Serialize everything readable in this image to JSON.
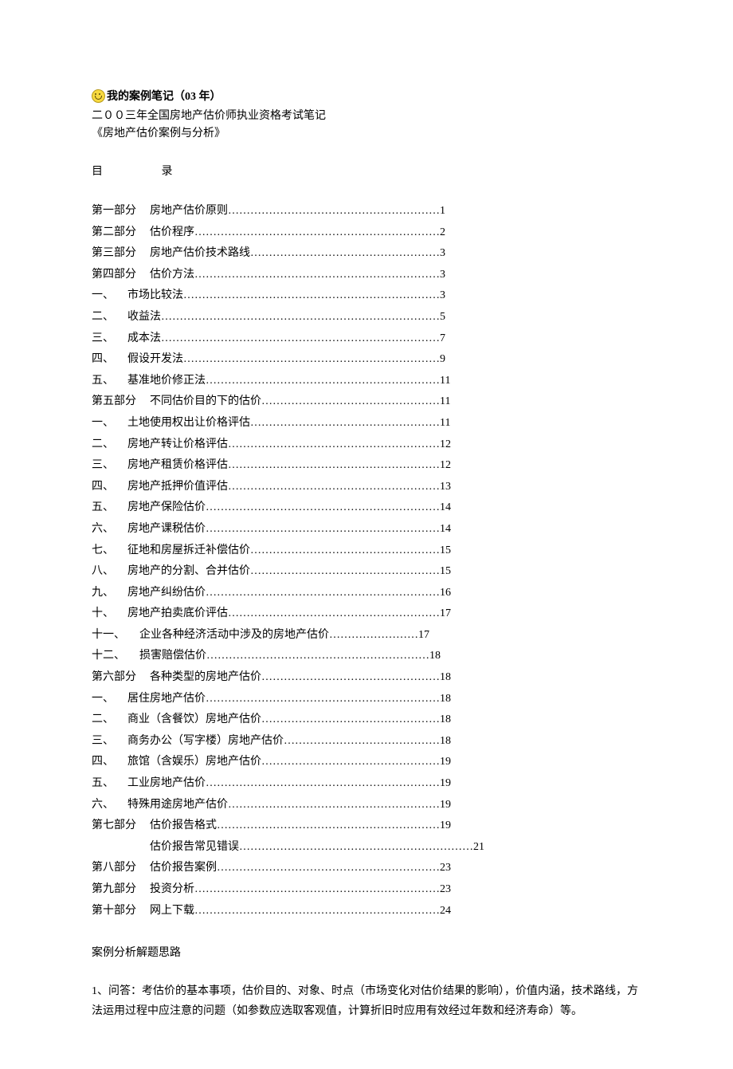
{
  "title": "我的案例笔记（03 年）",
  "subtitle1": "二００三年全国房地产估价师执业资格考试笔记",
  "subtitle2": "《房地产估价案例与分析》",
  "mu": "目",
  "lu": "录",
  "toc": [
    {
      "label": "第一部分",
      "cls": "toc-label1",
      "text": "房地产估价原则",
      "dots": "…………………………………………………",
      "page": "1"
    },
    {
      "label": "第二部分",
      "cls": "toc-label1",
      "text": "估价程序",
      "dots": "…………………………………………………………",
      "page": "2"
    },
    {
      "label": "第三部分",
      "cls": "toc-label1",
      "text": "房地产估价技术路线",
      "dots": "……………………………………………",
      "page": "3"
    },
    {
      "label": "第四部分",
      "cls": "toc-label1",
      "text": "估价方法",
      "dots": "…………………………………………………………",
      "page": "3"
    },
    {
      "label": "一、",
      "cls": "toc-label2",
      "text": "市场比较法",
      "dots": "……………………………………………………………",
      "page": "3"
    },
    {
      "label": "二、",
      "cls": "toc-label2",
      "text": "收益法",
      "dots": "…………………………………………………………………",
      "page": "5"
    },
    {
      "label": "三、",
      "cls": "toc-label2",
      "text": "成本法",
      "dots": "…………………………………………………………………",
      "page": "7"
    },
    {
      "label": "四、",
      "cls": "toc-label2",
      "text": "假设开发法",
      "dots": "……………………………………………………………",
      "page": "9"
    },
    {
      "label": "五、",
      "cls": "toc-label2",
      "text": "基准地价修正法",
      "dots": "………………………………………………………",
      "page": "11"
    },
    {
      "label": "第五部分",
      "cls": "toc-label1",
      "text": "不同估价目的下的估价",
      "dots": "…………………………………………",
      "page": "11"
    },
    {
      "label": "一、",
      "cls": "toc-label2",
      "text": "土地使用权出让价格评估",
      "dots": "……………………………………………",
      "page": "11"
    },
    {
      "label": "二、",
      "cls": "toc-label2",
      "text": "房地产转让价格评估",
      "dots": "…………………………………………………",
      "page": "12"
    },
    {
      "label": "三、",
      "cls": "toc-label2",
      "text": "房地产租赁价格评估",
      "dots": "…………………………………………………",
      "page": "12"
    },
    {
      "label": "四、",
      "cls": "toc-label2",
      "text": "房地产抵押价值评估",
      "dots": "…………………………………………………",
      "page": "13"
    },
    {
      "label": "五、",
      "cls": "toc-label2",
      "text": "房地产保险估价",
      "dots": "………………………………………………………",
      "page": "14"
    },
    {
      "label": "六、",
      "cls": "toc-label2",
      "text": "房地产课税估价",
      "dots": "………………………………………………………",
      "page": "14"
    },
    {
      "label": "七、",
      "cls": "toc-label2",
      "text": "征地和房屋拆迁补偿估价",
      "dots": "……………………………………………",
      "page": "15"
    },
    {
      "label": "八、",
      "cls": "toc-label2",
      "text": "房地产的分割、合并估价",
      "dots": "……………………………………………",
      "page": "15"
    },
    {
      "label": "九、",
      "cls": "toc-label2",
      "text": "房地产纠纷估价",
      "dots": "………………………………………………………",
      "page": "16"
    },
    {
      "label": "十、",
      "cls": "toc-label2",
      "text": "房地产拍卖底价评估",
      "dots": "…………………………………………………",
      "page": "17"
    },
    {
      "label": "十一、",
      "cls": "toc-label3",
      "text": "企业各种经济活动中涉及的房地产估价",
      "dots": "……………………",
      "page": "17"
    },
    {
      "label": "十二、",
      "cls": "toc-label3",
      "text": "损害赔偿估价",
      "dots": "……………………………………………………",
      "page": "18"
    },
    {
      "label": "第六部分",
      "cls": "toc-label1",
      "text": "各种类型的房地产估价",
      "dots": "…………………………………………",
      "page": "18"
    },
    {
      "label": "一、",
      "cls": "toc-label2",
      "text": "居住房地产估价",
      "dots": "………………………………………………………",
      "page": "18"
    },
    {
      "label": "二、",
      "cls": "toc-label2",
      "text": "商业（含餐饮）房地产估价",
      "dots": "…………………………………………",
      "page": "18"
    },
    {
      "label": "三、",
      "cls": "toc-label2",
      "text": "商务办公（写字楼）房地产估价",
      "dots": "……………………………………",
      "page": "18"
    },
    {
      "label": "四、",
      "cls": "toc-label2",
      "text": "旅馆（含娱乐）房地产估价",
      "dots": "…………………………………………",
      "page": "19"
    },
    {
      "label": "五、",
      "cls": "toc-label2",
      "text": "工业房地产估价",
      "dots": "………………………………………………………",
      "page": "19"
    },
    {
      "label": "六、",
      "cls": "toc-label2",
      "text": "特殊用途房地产估价",
      "dots": "…………………………………………………",
      "page": "19"
    },
    {
      "label": "第七部分",
      "cls": "toc-label1",
      "text": "估价报告格式",
      "dots": "……………………………………………………",
      "page": "19"
    },
    {
      "label": "",
      "cls": "toc-label-empty",
      "text": "估价报告常见错误",
      "dots": "………………………………………………………",
      "page": "21"
    },
    {
      "label": "第八部分",
      "cls": "toc-label1",
      "text": "估价报告案例",
      "dots": "……………………………………………………",
      "page": "23"
    },
    {
      "label": "第九部分",
      "cls": "toc-label1",
      "text": "投资分析",
      "dots": "…………………………………………………………",
      "page": "23"
    },
    {
      "label": "第十部分",
      "cls": "toc-label1",
      "text": "网上下载",
      "dots": "…………………………………………………………",
      "page": "24"
    }
  ],
  "section_heading": "案例分析解题思路",
  "body_para": "1、问答：考估价的基本事项，估价目的、对象、时点（市场变化对估价结果的影响），价值内涵，技术路线，方法运用过程中应注意的问题（如参数应选取客观值，计算折旧时应用有效经过年数和经济寿命）等。"
}
